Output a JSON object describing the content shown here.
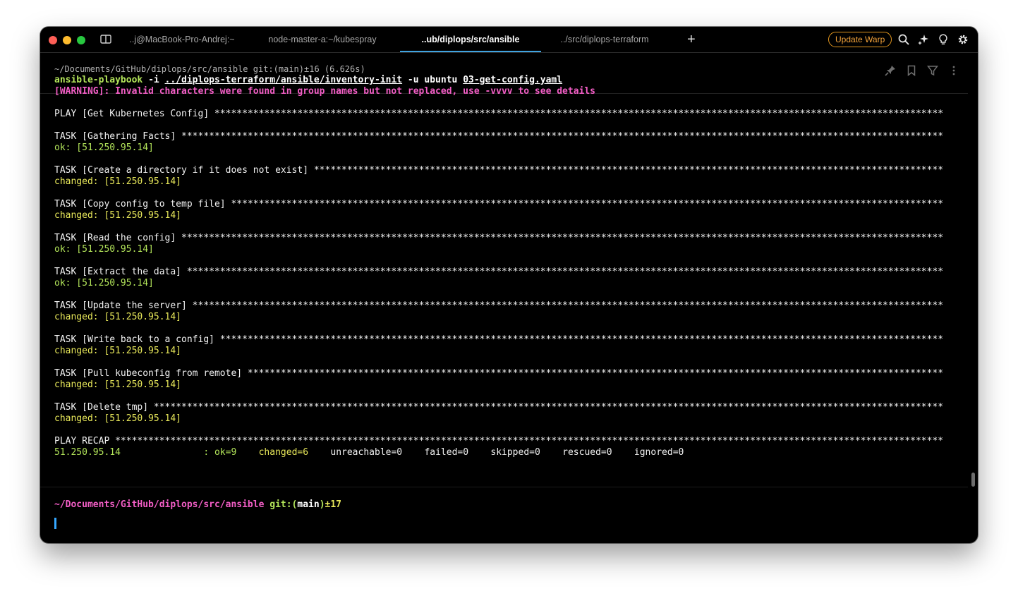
{
  "window": {
    "tabs": [
      {
        "label": "..j@MacBook-Pro-Andrej:~",
        "active": false
      },
      {
        "label": "node-master-a:~/kubespray",
        "active": false
      },
      {
        "label": "..ub/diplops/src/ansible",
        "active": true
      },
      {
        "label": "../src/diplops-terraform",
        "active": false
      }
    ],
    "new_tab_glyph": "+",
    "update_label": "Update Warp",
    "toolbar_icons": [
      "search-icon",
      "ai-sparkle-icon",
      "lightbulb-icon",
      "settings-gear-icon"
    ],
    "colors": {
      "accent_tab": "#3fa3e0",
      "update": "#f2a23a",
      "green": "#b3e55a",
      "yellow": "#e8e85a",
      "pink": "#f35ec6"
    }
  },
  "block": {
    "header": "~/Documents/GitHub/diplops/src/ansible git:(main)±16 (6.626s)",
    "command": {
      "bin": "ansible-playbook",
      "flag_i": "-i",
      "inventory": "../diplops-terraform/ansible/inventory-init",
      "flag_u": "-u",
      "user": "ubuntu",
      "playbook": "03-get-config.yaml"
    },
    "warning": "[WARNING]: Invalid characters were found in group names but not replaced, use -vvvv to see details",
    "play": "PLAY [Get Kubernetes Config]",
    "tasks": [
      {
        "name": "TASK [Gathering Facts]",
        "result": "ok: [51.250.95.14]",
        "status": "ok"
      },
      {
        "name": "TASK [Create a directory if it does not exist]",
        "result": "changed: [51.250.95.14]",
        "status": "changed"
      },
      {
        "name": "TASK [Copy config to temp file]",
        "result": "changed: [51.250.95.14]",
        "status": "changed"
      },
      {
        "name": "TASK [Read the config]",
        "result": "ok: [51.250.95.14]",
        "status": "ok"
      },
      {
        "name": "TASK [Extract the data]",
        "result": "ok: [51.250.95.14]",
        "status": "ok"
      },
      {
        "name": "TASK [Update the server]",
        "result": "changed: [51.250.95.14]",
        "status": "changed"
      },
      {
        "name": "TASK [Write back to a config]",
        "result": "changed: [51.250.95.14]",
        "status": "changed"
      },
      {
        "name": "TASK [Pull kubeconfig from remote]",
        "result": "changed: [51.250.95.14]",
        "status": "changed"
      },
      {
        "name": "TASK [Delete tmp]",
        "result": "changed: [51.250.95.14]",
        "status": "changed"
      }
    ],
    "recap_title": "PLAY RECAP",
    "recap": {
      "host": "51.250.95.14",
      "sep": ":",
      "ok": "ok=9",
      "changed": "changed=6",
      "unreachable": "unreachable=0",
      "failed": "failed=0",
      "skipped": "skipped=0",
      "rescued": "rescued=0",
      "ignored": "ignored=0"
    },
    "actions": [
      "pin-icon",
      "bookmark-icon",
      "filter-icon",
      "more-icon"
    ]
  },
  "prompt": {
    "path": "~/Documents/GitHub/diplops/src/ansible",
    "git_open": " git:(",
    "branch": "main",
    "git_close": ")",
    "count": "±17"
  }
}
